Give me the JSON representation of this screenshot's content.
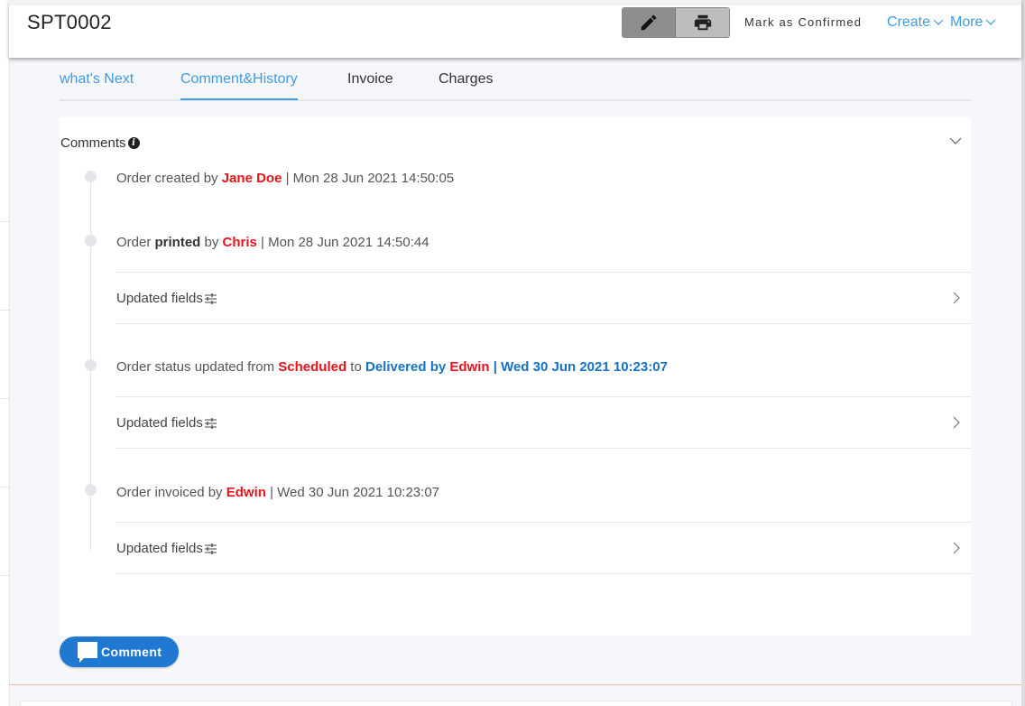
{
  "header": {
    "order_id": "SPT0002",
    "edit_icon": "pencil-icon",
    "print_icon": "printer-icon",
    "mark_confirmed": "Mark as Confirmed",
    "create": "Create",
    "more": "More"
  },
  "tabs": [
    {
      "label": "what's Next"
    },
    {
      "label": "Comment&History"
    },
    {
      "label": "Invoice"
    },
    {
      "label": "Charges"
    }
  ],
  "comments": {
    "title": "Comments",
    "info_icon": "info-icon"
  },
  "entries": [
    {
      "pre": "Order created by ",
      "user": "Jane Doe",
      "time": " | Mon 28 Jun 2021 14:50:05"
    },
    {
      "pre": "Order ",
      "action": "printed",
      "mid": " by ",
      "user": "Chris",
      "time": " | Mon 28 Jun 2021 14:50:44"
    },
    {
      "pre": "Order status updated from ",
      "from": "Scheduled",
      "to_word": " to ",
      "to": "Delivered by ",
      "user": "Edwin",
      "time": " | Wed 30 Jun 2021 10:23:07"
    },
    {
      "pre": "Order invoiced by ",
      "user": "Edwin",
      "time": " | Wed 30 Jun 2021 10:23:07"
    }
  ],
  "updated_fields_label": "Updated fields",
  "comment_button": "Comment",
  "colors": {
    "accent": "#3f9be6",
    "user_red": "#e8141b",
    "status_blue": "#1672c8",
    "button_blue": "#1f78d1"
  }
}
